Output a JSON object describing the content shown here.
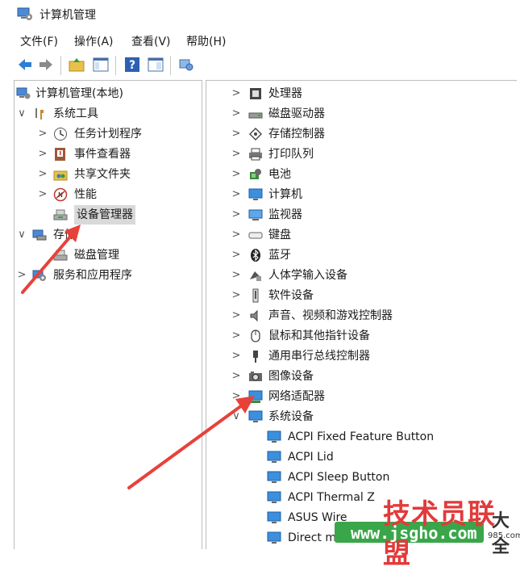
{
  "window": {
    "title": "计算机管理",
    "icon": "computer-management-icon"
  },
  "menu": [
    {
      "id": "file",
      "label": "文件(F)"
    },
    {
      "id": "action",
      "label": "操作(A)"
    },
    {
      "id": "view",
      "label": "查看(V)"
    },
    {
      "id": "help",
      "label": "帮助(H)"
    }
  ],
  "toolbar": [
    "back-arrow-icon",
    "forward-arrow-icon",
    "up-folder-icon",
    "show-hide-tree-icon",
    "help-icon",
    "export-list-icon",
    "refresh-icon"
  ],
  "left_tree": [
    {
      "label": "计算机管理(本地)",
      "icon": "computer-management-icon",
      "chev": "",
      "level": 0
    },
    {
      "label": "系统工具",
      "icon": "tools-icon",
      "chev": "∨",
      "level": 0
    },
    {
      "label": "任务计划程序",
      "icon": "clock-icon",
      "chev": ">",
      "level": 1
    },
    {
      "label": "事件查看器",
      "icon": "event-viewer-icon",
      "chev": ">",
      "level": 1
    },
    {
      "label": "共享文件夹",
      "icon": "shared-folder-icon",
      "chev": ">",
      "level": 1
    },
    {
      "label": "性能",
      "icon": "performance-icon",
      "chev": ">",
      "level": 1
    },
    {
      "label": "设备管理器",
      "icon": "device-manager-icon",
      "chev": "",
      "level": 1,
      "selected": true
    },
    {
      "label": "存储",
      "icon": "storage-icon",
      "chev": "∨",
      "level": 0
    },
    {
      "label": "磁盘管理",
      "icon": "disk-management-icon",
      "chev": "",
      "level": 1
    },
    {
      "label": "服务和应用程序",
      "icon": "services-icon",
      "chev": ">",
      "level": 0
    }
  ],
  "right_tree": [
    {
      "label": "处理器",
      "icon": "cpu-icon",
      "chev": ">"
    },
    {
      "label": "磁盘驱动器",
      "icon": "disk-drive-icon",
      "chev": ">"
    },
    {
      "label": "存储控制器",
      "icon": "storage-controller-icon",
      "chev": ">"
    },
    {
      "label": "打印队列",
      "icon": "printer-icon",
      "chev": ">"
    },
    {
      "label": "电池",
      "icon": "battery-icon",
      "chev": ">"
    },
    {
      "label": "计算机",
      "icon": "monitor-icon",
      "chev": ">"
    },
    {
      "label": "监视器",
      "icon": "display-icon",
      "chev": ">"
    },
    {
      "label": "键盘",
      "icon": "keyboard-icon",
      "chev": ">"
    },
    {
      "label": "蓝牙",
      "icon": "bluetooth-icon",
      "chev": ">"
    },
    {
      "label": "人体学输入设备",
      "icon": "hid-icon",
      "chev": ">"
    },
    {
      "label": "软件设备",
      "icon": "software-device-icon",
      "chev": ">"
    },
    {
      "label": "声音、视频和游戏控制器",
      "icon": "speaker-icon",
      "chev": ">"
    },
    {
      "label": "鼠标和其他指针设备",
      "icon": "mouse-icon",
      "chev": ">"
    },
    {
      "label": "通用串行总线控制器",
      "icon": "usb-icon",
      "chev": ">"
    },
    {
      "label": "图像设备",
      "icon": "camera-icon",
      "chev": ">"
    },
    {
      "label": "网络适配器",
      "icon": "network-adapter-icon",
      "chev": ">"
    },
    {
      "label": "系统设备",
      "icon": "system-device-icon",
      "chev": "∨"
    },
    {
      "label": "ACPI Fixed Feature Button",
      "icon": "monitor-icon",
      "chev": "",
      "child": true
    },
    {
      "label": "ACPI Lid",
      "icon": "monitor-icon",
      "chev": "",
      "child": true
    },
    {
      "label": "ACPI Sleep Button",
      "icon": "monitor-icon",
      "chev": "",
      "child": true
    },
    {
      "label": "ACPI Thermal Z",
      "icon": "monitor-icon",
      "chev": "",
      "child": true
    },
    {
      "label": "ASUS Wire",
      "icon": "monitor-icon",
      "chev": "",
      "child": true
    },
    {
      "label": "Direct m",
      "icon": "monitor-icon",
      "chev": "",
      "child": true
    }
  ],
  "watermark": {
    "main": "技术员联盟",
    "sub": "大全",
    "url": "www.jsgho.com",
    "small": "985.com"
  },
  "colors": {
    "arrow": "#e8413a",
    "accent": "#2d7fd3",
    "watermark_green": "#3aa64a",
    "watermark_red": "#e23a3a"
  }
}
